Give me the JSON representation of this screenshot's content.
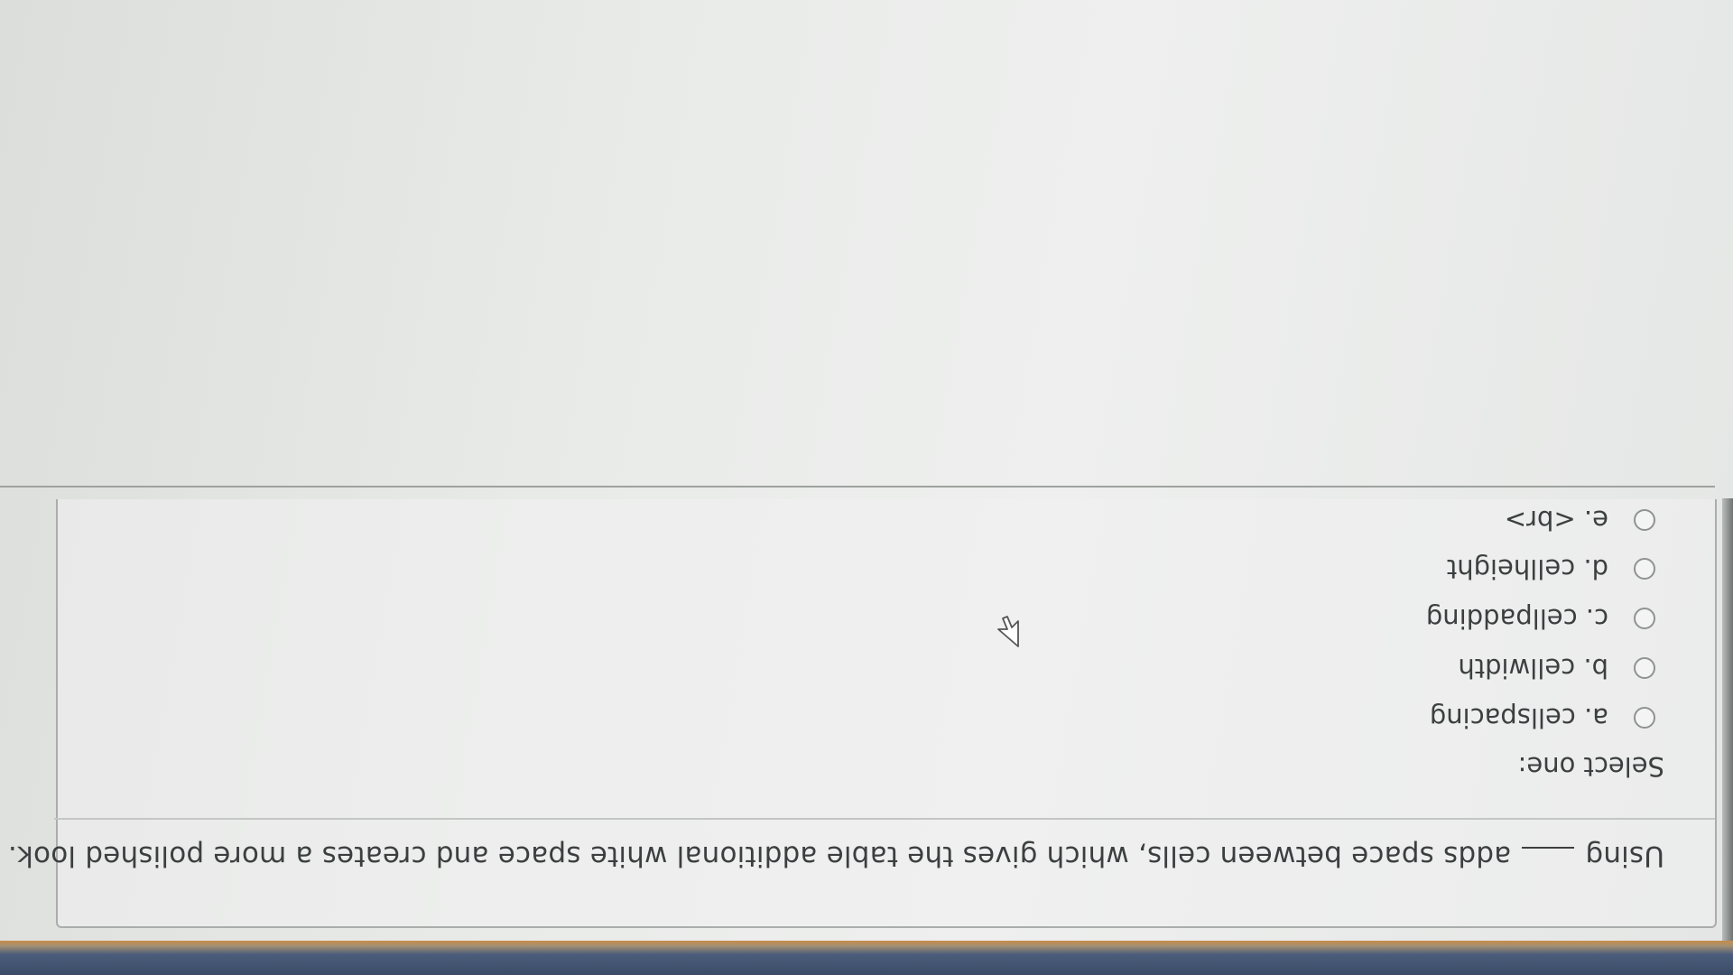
{
  "question": {
    "before_blank": "Using",
    "after_blank": "adds space between cells, which gives the table additional white space and creates a more polished look."
  },
  "prompt": "Select one:",
  "options": [
    {
      "label": "a. cellspacing"
    },
    {
      "label": "b. cellwidth"
    },
    {
      "label": "c. cellpadding"
    },
    {
      "label": "d. cellheight"
    },
    {
      "label": "e. <br>"
    }
  ],
  "colors": {
    "text": "#3c3f40",
    "background": "#e9ebe9",
    "border": "#a9adab"
  }
}
